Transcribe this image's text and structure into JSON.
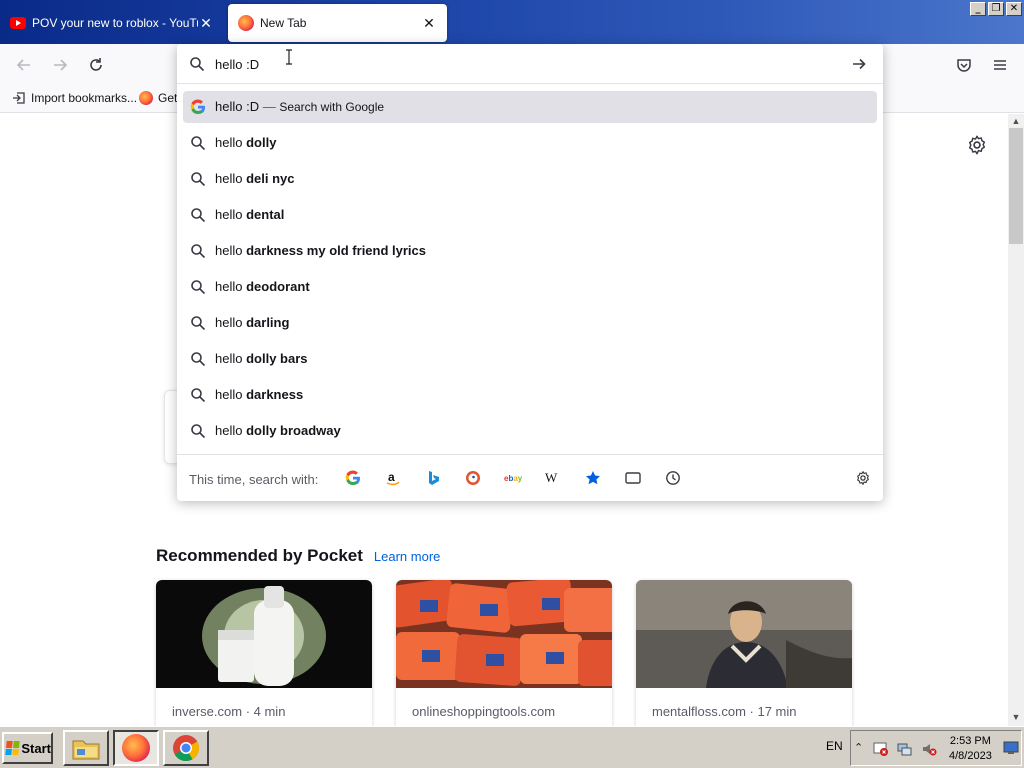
{
  "tabs": [
    {
      "title": "POV your new to roblox - YouTube",
      "active": false
    },
    {
      "title": "New Tab",
      "active": true
    }
  ],
  "bookmarks": [
    {
      "label": "Import bookmarks..."
    },
    {
      "label": "Get"
    }
  ],
  "urlbar": {
    "value": "hello :D"
  },
  "suggestions_first": {
    "query": "hello :D",
    "separator": "—",
    "action": "Search with Google"
  },
  "suggestions": [
    {
      "prefix": "hello",
      "completion": "dolly"
    },
    {
      "prefix": "hello",
      "completion": "deli nyc"
    },
    {
      "prefix": "hello",
      "completion": "dental"
    },
    {
      "prefix": "hello",
      "completion": "darkness my old friend lyrics"
    },
    {
      "prefix": "hello",
      "completion": "deodorant"
    },
    {
      "prefix": "hello",
      "completion": "darling"
    },
    {
      "prefix": "hello",
      "completion": "dolly bars"
    },
    {
      "prefix": "hello",
      "completion": "darkness"
    },
    {
      "prefix": "hello",
      "completion": "dolly broadway"
    }
  ],
  "search_with": {
    "label": "This time, search with:",
    "engines": [
      "google-icon",
      "amazon-icon",
      "bing-icon",
      "duckduckgo-icon",
      "ebay-icon",
      "wikipedia-icon",
      "bookmarks-icon",
      "tabs-icon",
      "history-icon"
    ]
  },
  "pocket": {
    "title": "Recommended by Pocket",
    "learn_more": "Learn more",
    "cards": [
      {
        "meta": "inverse.com · 4 min"
      },
      {
        "meta": "onlineshoppingtools.com"
      },
      {
        "meta": "mentalfloss.com · 17 min"
      }
    ]
  },
  "taskbar": {
    "start_label": "Start",
    "language": "EN",
    "time": "2:53 PM",
    "date": "4/8/2023"
  },
  "colors": {
    "accent": "#0061e0",
    "highlight_row": "#e0e0e6",
    "titlebar": "#1c44a8"
  }
}
